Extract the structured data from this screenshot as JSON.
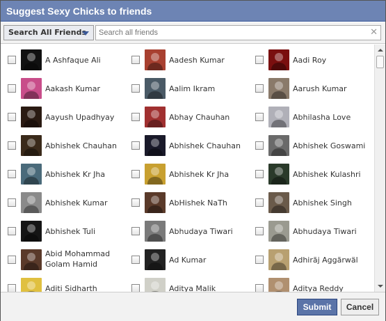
{
  "dialog": {
    "title": "Suggest Sexy Chicks to friends"
  },
  "filter": {
    "label": "Search All Friends",
    "search_placeholder": "Search all friends",
    "clear_glyph": "✕"
  },
  "friends": [
    {
      "name": "A Ashfaque Ali",
      "color": "#111111"
    },
    {
      "name": "Aadesh Kumar",
      "color": "#a84030"
    },
    {
      "name": "Aadi Roy",
      "color": "#7a0f0f"
    },
    {
      "name": "Aakash Kumar",
      "color": "#c84d8a"
    },
    {
      "name": "Aalim Ikram",
      "color": "#4a5a66"
    },
    {
      "name": "Aarush Kumar",
      "color": "#8a7a6a"
    },
    {
      "name": "Aayush Upadhyay",
      "color": "#2a1a12"
    },
    {
      "name": "Abhay Chauhan",
      "color": "#a03030"
    },
    {
      "name": "Abhilasha Love",
      "color": "#b0b0b8"
    },
    {
      "name": "Abhishek Chauhan",
      "color": "#3a2a1a"
    },
    {
      "name": "Abhishek Chauhan",
      "color": "#1a1a2a"
    },
    {
      "name": "Abhishek Goswami",
      "color": "#6a6a6a"
    },
    {
      "name": "Abhishek Kr Jha",
      "color": "#4a6a7a"
    },
    {
      "name": "Abhishek Kr Jha",
      "color": "#c8a030"
    },
    {
      "name": "Abhishek Kulashri",
      "color": "#2a3a2a"
    },
    {
      "name": "Abhishek Kumar",
      "color": "#8a8a8a"
    },
    {
      "name": "AbHishek NaTh",
      "color": "#5a3a2a"
    },
    {
      "name": "Abhishek Singh",
      "color": "#6a5a4a"
    },
    {
      "name": "Abhishek Tuli",
      "color": "#151515"
    },
    {
      "name": "Abhudaya Tiwari",
      "color": "#7a7a7a"
    },
    {
      "name": "Abhudaya Tiwari",
      "color": "#9a9a90"
    },
    {
      "name": "Abid Mohammad Golam Hamid",
      "color": "#5a3a2a"
    },
    {
      "name": "Ad Kumar",
      "color": "#222222"
    },
    {
      "name": "Adhirãj Aggãrwäl",
      "color": "#b8a070"
    },
    {
      "name": "Aditi Sidharth",
      "color": "#e0c040"
    },
    {
      "name": "Aditya Malik",
      "color": "#d0d0c8"
    },
    {
      "name": "Aditya Reddy",
      "color": "#b09070"
    }
  ],
  "footer": {
    "submit_label": "Submit",
    "cancel_label": "Cancel"
  }
}
